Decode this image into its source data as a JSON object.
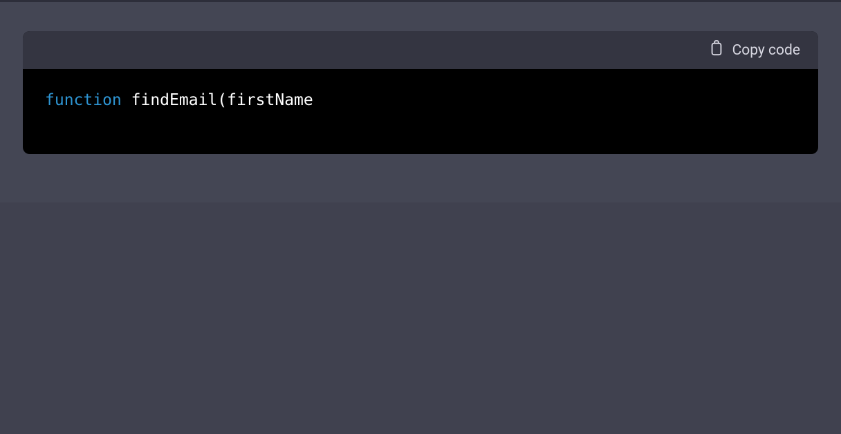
{
  "codeBlock": {
    "header": {
      "copyLabel": "Copy code"
    },
    "content": {
      "tokens": [
        {
          "type": "keyword",
          "text": "function"
        },
        {
          "type": "space",
          "text": " "
        },
        {
          "type": "function",
          "text": "findEmail"
        },
        {
          "type": "punctuation",
          "text": "("
        },
        {
          "type": "param",
          "text": "firstName"
        }
      ]
    }
  }
}
